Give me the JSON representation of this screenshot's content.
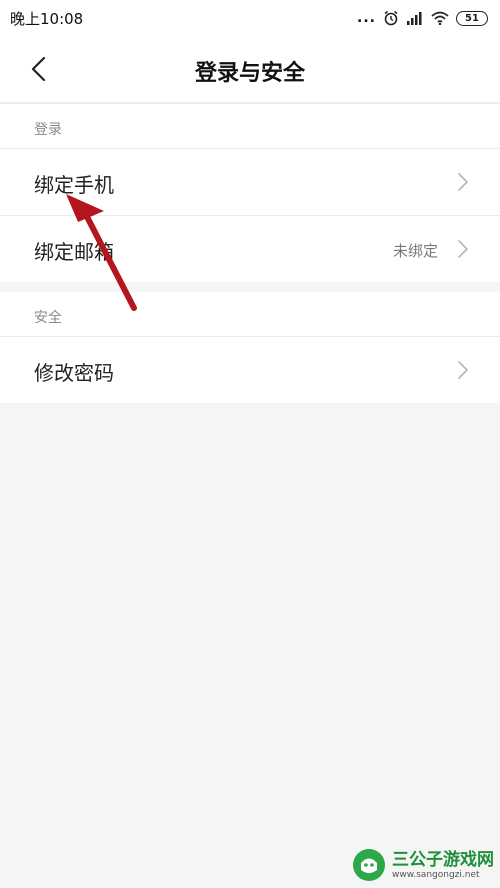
{
  "status_bar": {
    "time": "晚上10:08",
    "dots": "...",
    "battery": "51",
    "icons": [
      "alarm-icon",
      "signal-icon",
      "wifi-icon",
      "battery-icon"
    ]
  },
  "header": {
    "title": "登录与安全",
    "back_icon": "chevron-left-icon"
  },
  "sections": [
    {
      "label": "登录",
      "rows": [
        {
          "label": "绑定手机",
          "value": ""
        },
        {
          "label": "绑定邮箱",
          "value": "未绑定"
        }
      ]
    },
    {
      "label": "安全",
      "rows": [
        {
          "label": "修改密码",
          "value": ""
        }
      ]
    }
  ],
  "annotation": {
    "type": "arrow",
    "color": "#b3161c"
  },
  "watermark": {
    "name": "三公子游戏网",
    "url": "www.sangongzi.net"
  },
  "colors": {
    "background": "#f5f5f5",
    "card": "#ffffff",
    "watermark_green": "#1e8f3a",
    "arrow_red": "#b3161c"
  }
}
